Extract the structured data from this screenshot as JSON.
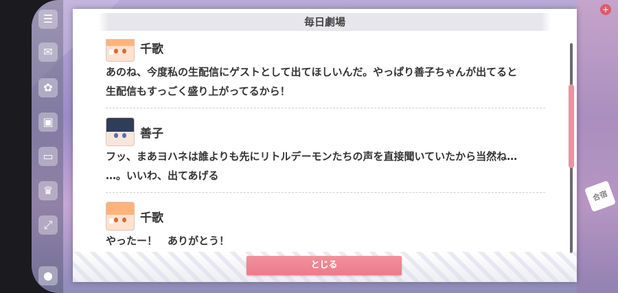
{
  "modal": {
    "title": "毎日劇場",
    "close_label": "とじる"
  },
  "dialogue": [
    {
      "speaker": "千歌",
      "lines": [
        "あのね、今度私の生配信にゲストとして出てほしいんだ。やっぱり善子ちゃんが出てると",
        "生配信もすっごく盛り上がってるから！"
      ]
    },
    {
      "speaker": "善子",
      "lines": [
        "フッ、まあヨハネは誰よりも先にリトルデーモンたちの声を直接聞いていたから当然ね…",
        "…。いいわ、出てあげる"
      ]
    },
    {
      "speaker": "千歌",
      "lines": [
        "やったー！　ありがとう！"
      ]
    }
  ],
  "background": {
    "right_tag": "合宿"
  },
  "colors": {
    "accent": "#ea7d8a",
    "scroll_thumb": "#f08f9d"
  }
}
